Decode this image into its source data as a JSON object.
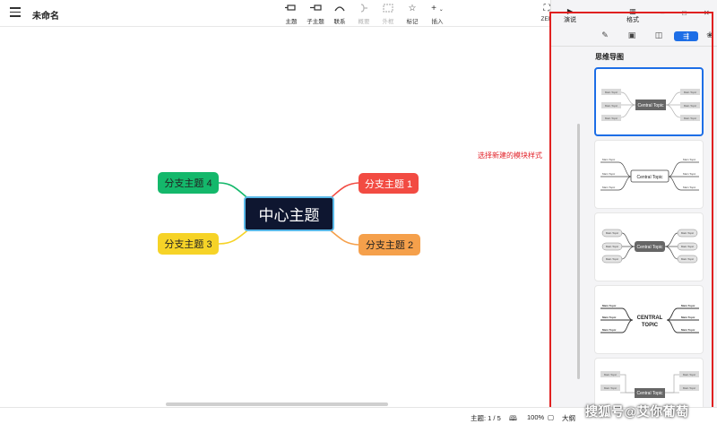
{
  "app": {
    "doc_title": "未命名",
    "annotation": "选择新建的模块样式",
    "watermark": "搜狐号@艾你葡萄"
  },
  "toolbar": {
    "items": [
      {
        "label": "主题",
        "icon": "topic-icon",
        "enabled": true
      },
      {
        "label": "子主题",
        "icon": "subtopic-icon",
        "enabled": true
      },
      {
        "label": "联系",
        "icon": "relationship-icon",
        "enabled": true
      },
      {
        "label": "概要",
        "icon": "summary-icon",
        "enabled": false
      },
      {
        "label": "外框",
        "icon": "boundary-icon",
        "enabled": false
      },
      {
        "label": "标记",
        "icon": "star-icon",
        "enabled": true
      },
      {
        "label": "插入",
        "icon": "plus-icon",
        "enabled": true
      }
    ],
    "zen_label": "ZEN"
  },
  "mindmap": {
    "central": "中心主题",
    "branches": [
      "分支主题 1",
      "分支主题 2",
      "分支主题 3",
      "分支主题 4"
    ],
    "colors": {
      "b1": "#f24b42",
      "b2": "#f5a04b",
      "b3": "#f6d327",
      "b4": "#14b86b",
      "central": "#0e1630"
    }
  },
  "panel": {
    "tabs": [
      {
        "label": "演说",
        "icon": "play-icon"
      },
      {
        "label": "格式",
        "icon": "format-icon"
      }
    ],
    "section_title": "思维导图",
    "templates": [
      {
        "center": "Central Topic",
        "branch": "Main Topic",
        "selected": true
      },
      {
        "center": "Central Topic",
        "branch": "Main Topic",
        "selected": false
      },
      {
        "center": "Central Topic",
        "branch": "Main Topic",
        "selected": false
      },
      {
        "center": "CENTRAL TOPIC",
        "branch": "Main Topic",
        "selected": false
      },
      {
        "center": "Central Topic",
        "branch": "Main Topic",
        "selected": false
      }
    ],
    "accent": "#1d6ee6"
  },
  "status": {
    "topic_count": "主题: 1 / 5",
    "zoom": "100%",
    "outline_label": "大纲"
  }
}
